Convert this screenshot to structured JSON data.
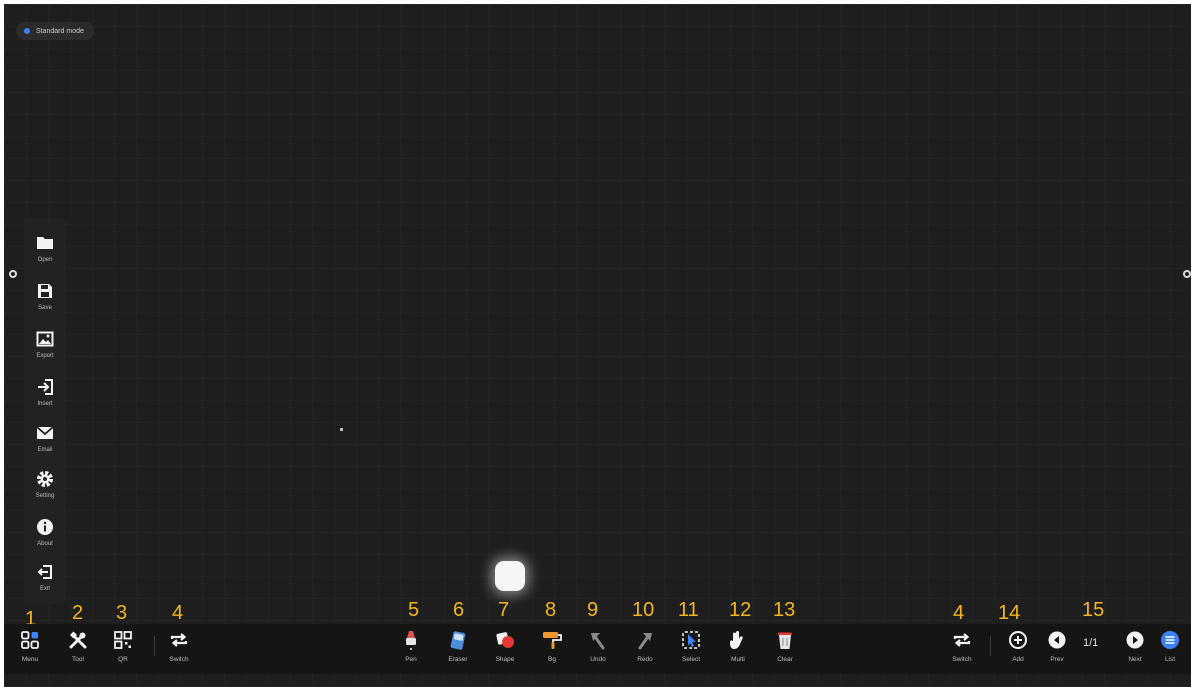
{
  "mode": {
    "label": "Standard mode",
    "dot_color": "#3b82f6"
  },
  "sidebar": {
    "items": [
      {
        "label": "Open",
        "icon": "folder-icon"
      },
      {
        "label": "Save",
        "icon": "save-icon"
      },
      {
        "label": "Export",
        "icon": "image-icon"
      },
      {
        "label": "Insert",
        "icon": "insert-icon"
      },
      {
        "label": "Email",
        "icon": "mail-icon"
      },
      {
        "label": "Setting",
        "icon": "gear-icon"
      },
      {
        "label": "About",
        "icon": "info-icon"
      },
      {
        "label": "Exit",
        "icon": "exit-icon"
      }
    ]
  },
  "toolbar": {
    "menu": "Menu",
    "tool": "Tool",
    "qr": "QR",
    "switch": "Switch",
    "pen": "Pen",
    "eraser": "Eraser",
    "shape": "Shape",
    "bg": "Bg",
    "undo": "Undo",
    "redo": "Redo",
    "select": "Select",
    "multi": "Multi",
    "clear": "Clear",
    "switch_right": "Switch",
    "add": "Add",
    "prev": "Prev",
    "page": "1/1",
    "next": "Next",
    "list": "List"
  },
  "callouts": {
    "n1": "1",
    "n2": "2",
    "n3": "3",
    "n4a": "4",
    "n5": "5",
    "n6": "6",
    "n7": "7",
    "n8": "8",
    "n9": "9",
    "n10": "10",
    "n11": "11",
    "n12": "12",
    "n13": "13",
    "n4b": "4",
    "n14": "14",
    "n15": "15"
  },
  "colors": {
    "canvas_bg": "#1e1e1e",
    "toolbar_bg": "#151515",
    "callout": "#f3b61f",
    "accent": "#3b82f6"
  }
}
